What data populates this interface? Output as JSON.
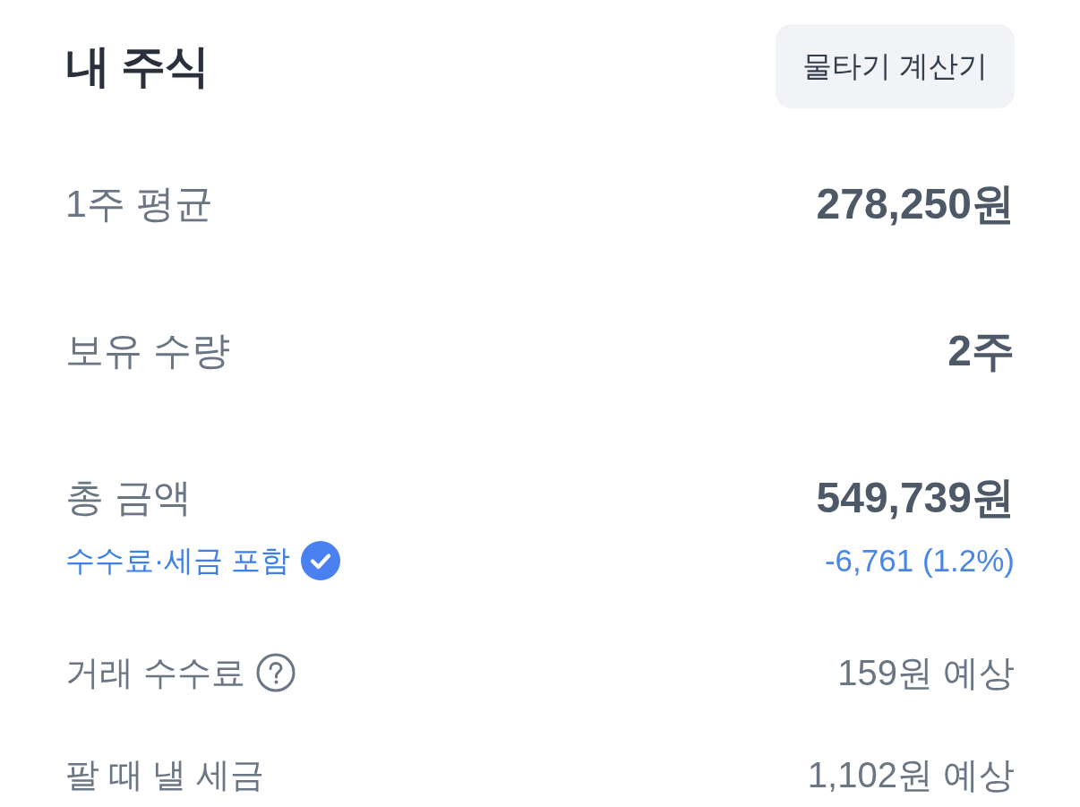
{
  "header": {
    "title": "내 주식",
    "button": "물타기 계산기"
  },
  "rows": [
    {
      "kind": "main",
      "label": "1주 평균",
      "value": "278,250원"
    },
    {
      "kind": "main",
      "label": "보유 수량",
      "value": "2주"
    },
    {
      "kind": "main",
      "label": "총 금액",
      "value": "549,739원",
      "note": {
        "label": "수수료·세금 포함",
        "checked": true
      },
      "change": "-6,761 (1.2%)"
    },
    {
      "kind": "minor",
      "label": "거래 수수료",
      "help": true,
      "value": "159원 예상"
    },
    {
      "kind": "minor",
      "label": "팔 때 낼 세금",
      "value": "1,102원 예상"
    }
  ]
}
